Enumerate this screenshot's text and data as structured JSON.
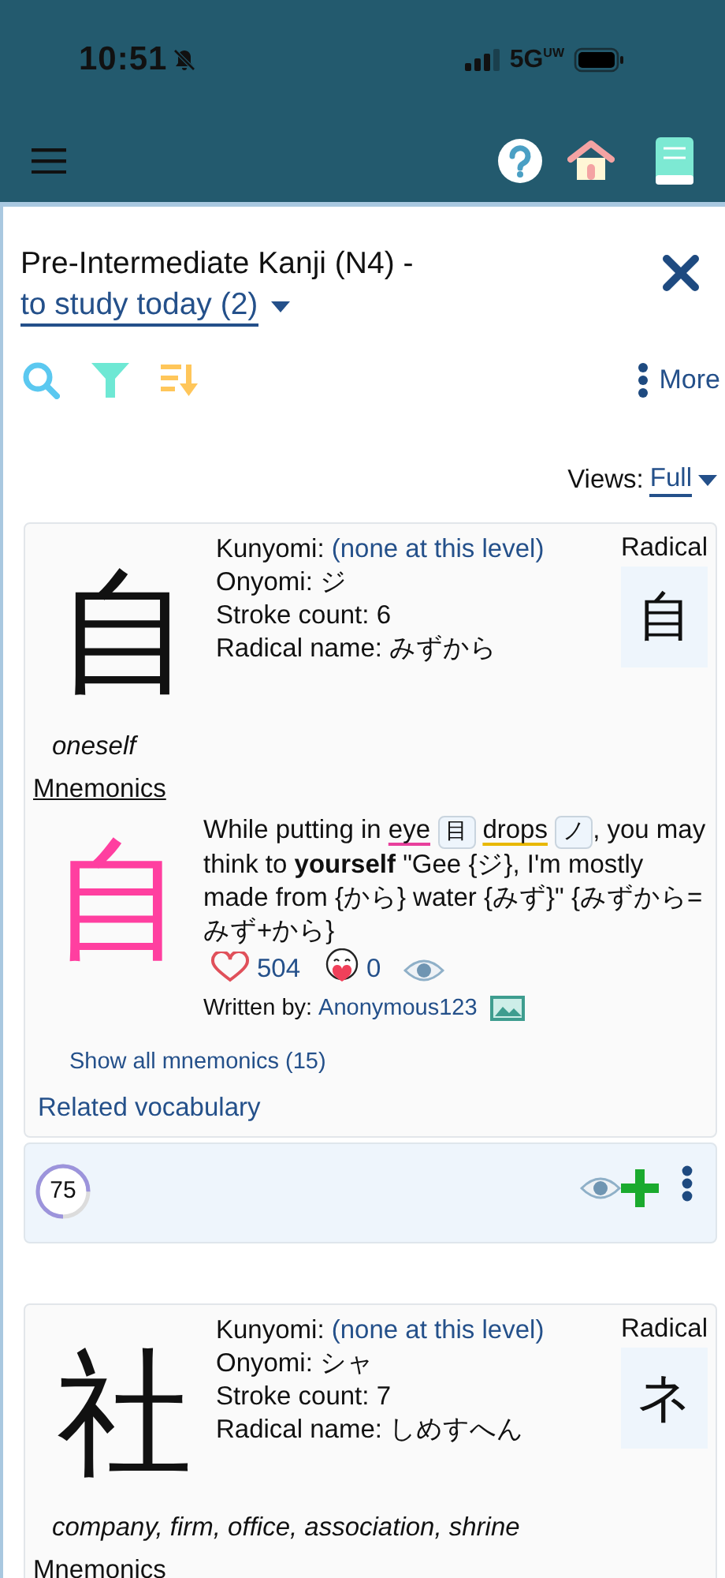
{
  "status_bar": {
    "time": "10:51",
    "network": "5G",
    "network_sup": "UW"
  },
  "heading": {
    "title": "Pre-Intermediate Kanji (N4) -",
    "list_filter": "to study today (2)"
  },
  "actions": {
    "more": "More"
  },
  "views": {
    "label": "Views:",
    "value": "Full"
  },
  "cards": [
    {
      "kanji": "自",
      "meaning": "oneself",
      "readings": [
        {
          "label": "Kunyomi:",
          "value": "(none at this level)",
          "kind": "link"
        },
        {
          "label": "Onyomi:",
          "value": "ジ",
          "kind": "plain"
        },
        {
          "label": "Stroke count:",
          "value": "6",
          "kind": "plain"
        },
        {
          "label": "Radical name:",
          "value": "みずから",
          "kind": "plain"
        }
      ],
      "radical_label": "Radical",
      "radical": "自",
      "mnemonics_heading": "Mnemonics",
      "mnemonic": {
        "kanji": "自",
        "segments": [
          {
            "kind": "text",
            "text": "While putting in "
          },
          {
            "kind": "underline",
            "text": "eye",
            "color": "#e8409c"
          },
          {
            "kind": "chip",
            "text": "目"
          },
          {
            "kind": "underline",
            "text": "drops",
            "color": "#e8b800"
          },
          {
            "kind": "chip",
            "text": "ノ"
          },
          {
            "kind": "text",
            "text": ", you may think to "
          },
          {
            "kind": "bold",
            "text": "yourself"
          },
          {
            "kind": "text",
            "text": " \"Gee {ジ}, I'm mostly made from {から} water {みず}\" {みずから=みず+から}"
          }
        ],
        "likes": "504",
        "favorites": "0",
        "author_label": "Written by:",
        "author": "Anonymous123",
        "show_all": "Show all mnemonics (15)"
      },
      "related": "Related vocabulary",
      "progress": {
        "score": "75",
        "level": 0.75
      }
    },
    {
      "kanji": "社",
      "meaning": "company, firm, office, association, shrine",
      "readings": [
        {
          "label": "Kunyomi:",
          "value": "(none at this level)",
          "kind": "link"
        },
        {
          "label": "Onyomi:",
          "value": "シャ",
          "kind": "plain"
        },
        {
          "label": "Stroke count:",
          "value": "7",
          "kind": "plain"
        },
        {
          "label": "Radical name:",
          "value": "しめすへん",
          "kind": "plain"
        }
      ],
      "radical_label": "Radical",
      "radical": "ネ",
      "mnemonics_heading": "Mnemonics"
    }
  ]
}
